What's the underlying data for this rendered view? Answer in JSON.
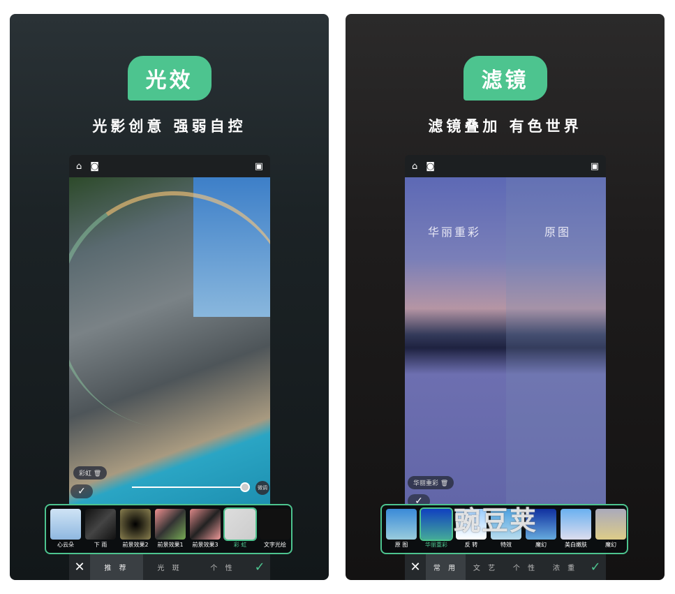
{
  "left": {
    "badge": "光效",
    "subtitle": "光影创意  强弱自控",
    "overlay_label": "彩虹",
    "fine_tune": "微调",
    "effects": [
      {
        "label": "心云朵",
        "color": "linear-gradient(#cfe3f5,#8fb8e0)"
      },
      {
        "label": "下 雨",
        "color": "linear-gradient(135deg,#111,#444,#111)"
      },
      {
        "label": "前景效果2",
        "color": "radial-gradient(#000,#8a8050)"
      },
      {
        "label": "前景效果1",
        "color": "linear-gradient(135deg,#f09090,#333,#7a5)"
      },
      {
        "label": "前景效果3",
        "color": "linear-gradient(135deg,#d88,#222,#e99)"
      },
      {
        "label": "彩 虹",
        "color": "linear-gradient(135deg,#ddd,#ccc)",
        "selected": true
      },
      {
        "label": "文字光绘",
        "color": "#111"
      }
    ],
    "tabs": [
      "推 荐",
      "光 斑",
      "个 性"
    ],
    "active_tab": 0
  },
  "right": {
    "badge": "滤镜",
    "subtitle": "滤镜叠加  有色世界",
    "compare_left": "华丽重彩",
    "compare_right": "原图",
    "filter_chip": "华丽重彩",
    "filters": [
      {
        "label": "原 图",
        "color": "linear-gradient(#3a8ad8,#9cd)"
      },
      {
        "label": "华丽重彩",
        "color": "linear-gradient(#1040c0,#4a9)",
        "selected": true
      },
      {
        "label": "反 转",
        "color": "linear-gradient(#9cf,#fff)"
      },
      {
        "label": "特效",
        "color": "linear-gradient(#4aa0e0,#bde)"
      },
      {
        "label": "魔幻",
        "color": "linear-gradient(#1030a0,#6ad)"
      },
      {
        "label": "美白嫩肤",
        "color": "linear-gradient(#6ab0f0,#dde)"
      },
      {
        "label": "魔幻",
        "color": "linear-gradient(#aab,#dc8)"
      }
    ],
    "tabs": [
      "常 用",
      "文 艺",
      "个 性",
      "浓 重"
    ],
    "active_tab": 0
  },
  "watermark": "豌豆荚",
  "colors": {
    "accent": "#4dc48f"
  }
}
